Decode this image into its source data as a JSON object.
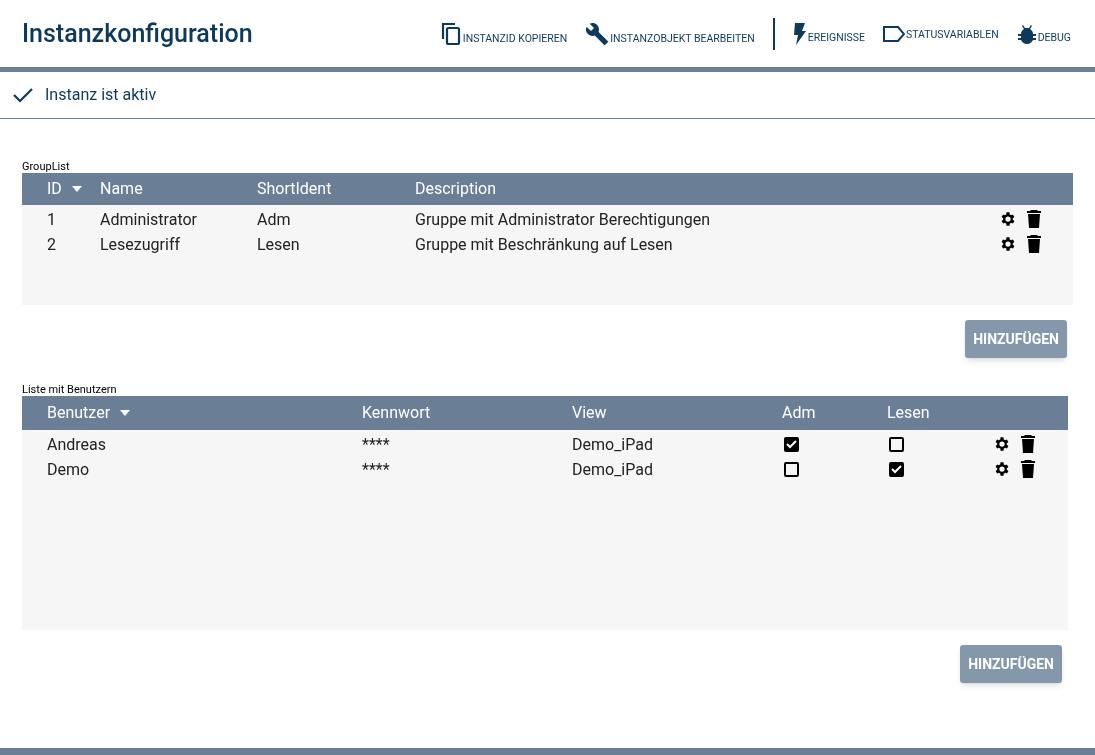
{
  "title": "Instanzkonfiguration",
  "toolbar": [
    {
      "kind": "copy",
      "label": "INSTANZID KOPIEREN"
    },
    {
      "kind": "wrench",
      "label": "INSTANZOBJEKT BEARBEITEN"
    },
    {
      "kind": "separator"
    },
    {
      "kind": "bolt",
      "label": "EREIGNISSE"
    },
    {
      "kind": "tag",
      "label": "STATUSVARIABLEN"
    },
    {
      "kind": "bug",
      "label": "DEBUG"
    }
  ],
  "status": {
    "active": true,
    "text": "Instanz ist aktiv"
  },
  "group_list": {
    "caption": "GroupList",
    "columns": [
      {
        "label": "ID",
        "sorted": true
      },
      {
        "label": "Name",
        "sorted": false
      },
      {
        "label": "ShortIdent",
        "sorted": false
      },
      {
        "label": "Description",
        "sorted": false
      }
    ],
    "rows": [
      {
        "cells": [
          "1",
          "Administrator",
          "Adm",
          "Gruppe mit Administrator Berechtigungen"
        ]
      },
      {
        "cells": [
          "2",
          "Lesezugriff",
          "Lesen",
          "Gruppe mit Beschränkung auf Lesen"
        ]
      }
    ],
    "add_button": "HINZUFÜGEN"
  },
  "user_list": {
    "caption": "Liste mit Benutzern",
    "columns": [
      {
        "label": "Benutzer",
        "sorted": true
      },
      {
        "label": "Kennwort",
        "sorted": false
      },
      {
        "label": "View",
        "sorted": false
      },
      {
        "label": "Adm",
        "sorted": false
      },
      {
        "label": "Lesen",
        "sorted": false
      }
    ],
    "rows": [
      {
        "user": "Andreas",
        "password": "****",
        "view": "Demo_iPad",
        "adm": true,
        "lesen": false
      },
      {
        "user": "Demo",
        "password": "****",
        "view": "Demo_iPad",
        "adm": false,
        "lesen": true
      }
    ],
    "add_button": "HINZUFÜGEN"
  }
}
